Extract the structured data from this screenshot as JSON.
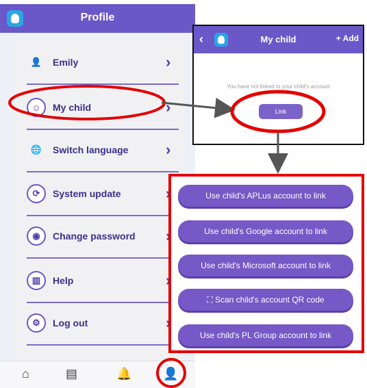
{
  "profile": {
    "title": "Profile",
    "menu": [
      {
        "label": "Emily",
        "icon": "user-avatar-icon",
        "glyph": "👤"
      },
      {
        "label": "My child",
        "icon": "child-face-icon",
        "glyph": "☺"
      },
      {
        "label": "Switch language",
        "icon": "globe-icon",
        "glyph": "🌐"
      },
      {
        "label": "System update",
        "icon": "refresh-icon",
        "glyph": "⟳"
      },
      {
        "label": "Change password",
        "icon": "eye-icon",
        "glyph": "◉"
      },
      {
        "label": "Help",
        "icon": "help-chart-icon",
        "glyph": "▥"
      },
      {
        "label": "Log out",
        "icon": "gear-icon",
        "glyph": "⚙"
      }
    ],
    "chevron": "›",
    "nav": {
      "home": "⌂",
      "list": "▤",
      "notifications": "🔔",
      "profile": "👤"
    }
  },
  "child_panel": {
    "back": "‹",
    "title": "My child",
    "add_label": "+ Add",
    "message": "You have not linked to your child's account",
    "link_label": "Link"
  },
  "link_options": [
    {
      "label": "Use child's APLus account to link"
    },
    {
      "label": "Use child's Google account to link"
    },
    {
      "label": "Use child's Microsoft account to link"
    },
    {
      "label": "⛶ Scan child's account QR code"
    },
    {
      "label": "Use child's PL Group account to link"
    }
  ],
  "colors": {
    "primary": "#6a58c9",
    "highlight": "#e50000"
  }
}
